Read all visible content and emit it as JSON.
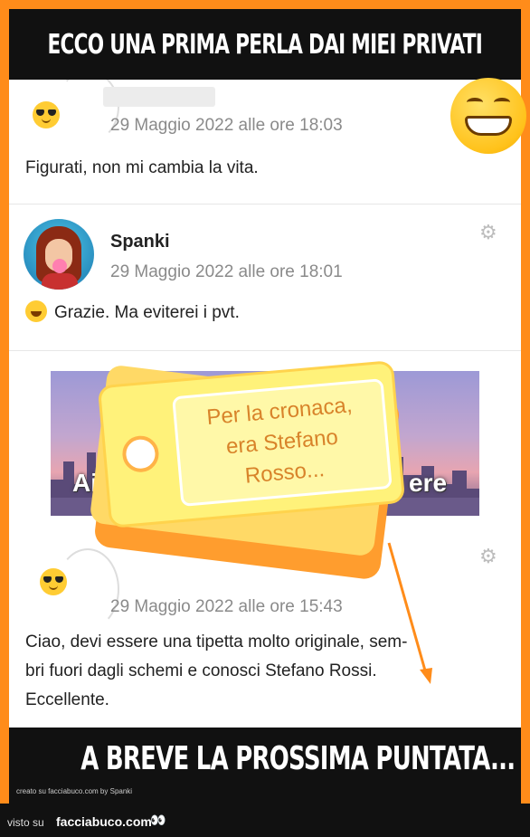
{
  "header": {
    "title": "ECCO UNA PRIMA PERLA DAI MIEI PRIVATI"
  },
  "posts": [
    {
      "timestamp": "29 Maggio 2022 alle ore 18:03",
      "text": "Figurati, non mi cambia la vita."
    },
    {
      "username": "Spanki",
      "timestamp": "29 Maggio 2022 alle ore 18:01",
      "text": "Grazie. Ma eviterei i pvt."
    },
    {
      "timestamp": "29 Maggio 2022 alle ore 15:43",
      "text_lines": [
        "Ciao, devi essere una tipetta molto originale, sem-",
        "bri fuori dagli schemi e conosci Stefano Rossi.",
        "Eccellente."
      ]
    }
  ],
  "banner": {
    "word_left": "Aiu",
    "word_right": "ere"
  },
  "tag": {
    "lines": [
      "Per la cronaca,",
      "era Stefano",
      "Rosso..."
    ]
  },
  "bottom_banner": {
    "title": "A BREVE LA PROSSIMA PUNTATA...",
    "credit": "creato su facciabuco.com     by Spanki"
  },
  "footer": {
    "visto_label": "visto su",
    "site": "facciabuco.com",
    "eyes": "👀"
  },
  "icons": {
    "gear": "gear-icon",
    "sunglasses": "sunglasses-emoji-icon",
    "laugh": "laughing-emoji-icon",
    "grin": "grinning-emoji-icon"
  },
  "colors": {
    "border": "#ff8c1a",
    "tag_text": "#d8832a",
    "arrow": "#ff8c1a"
  }
}
